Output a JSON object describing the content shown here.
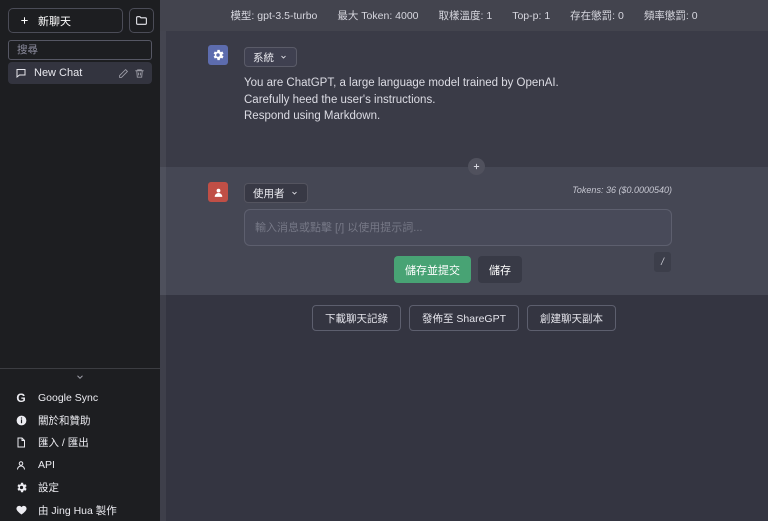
{
  "sidebar": {
    "new_chat_label": "新聊天",
    "search_placeholder": "搜尋",
    "chat_item_title": "New Chat",
    "menu": [
      {
        "icon": "google-icon",
        "label": "Google Sync"
      },
      {
        "icon": "info-icon",
        "label": "關於和贊助"
      },
      {
        "icon": "import-export-icon",
        "label": "匯入 / 匯出"
      },
      {
        "icon": "person-icon",
        "label": "API"
      },
      {
        "icon": "gear-icon",
        "label": "設定"
      },
      {
        "icon": "heart-icon",
        "label": "由 Jing Hua 製作"
      }
    ]
  },
  "topbar": {
    "items": [
      "模型: gpt-3.5-turbo",
      "最大 Token: 4000",
      "取樣溫度: 1",
      "Top-p: 1",
      "存在懲罰: 0",
      "頻率懲罰: 0"
    ]
  },
  "system_message": {
    "role_label": "系統",
    "lines": [
      "You are ChatGPT, a large language model trained by OpenAI.",
      "Carefully heed the user's instructions.",
      "Respond using Markdown."
    ]
  },
  "composer": {
    "role_label": "使用者",
    "tokens_label": "Tokens: 36 ($0.0000540)",
    "placeholder": "輸入消息或點擊 [/] 以使用提示詞...",
    "save_submit_label": "儲存並提交",
    "save_label": "儲存",
    "shortcut_key": "/"
  },
  "footer_actions": [
    "下載聊天記錄",
    "發佈至 ShareGPT",
    "創建聊天副本"
  ],
  "colors": {
    "accent_green": "#48a374",
    "system_avatar": "#5d6cae",
    "user_avatar": "#c04f46",
    "sidebar_bg": "#1d1e21",
    "main_bg": "#343541",
    "user_block_bg": "#454754",
    "topbar_bg": "#43444e"
  }
}
